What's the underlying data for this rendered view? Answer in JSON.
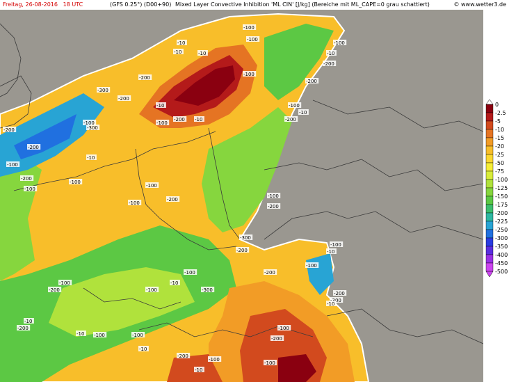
{
  "header": {
    "date": "Freitag, 26-08-2016",
    "time": "18 UTC",
    "model": "(GFS 0.25°) (D00+90)",
    "title": "Mixed Layer Convective Inhibition 'ML CIN' [J/kg] (Bereiche mit ML_CAPE=0 grau schattiert)",
    "credit": "© www.wetter3.de"
  },
  "legend": {
    "entries": [
      {
        "label": "0",
        "color": "#ffffff"
      },
      {
        "label": "-2.5",
        "color": "#8a0010"
      },
      {
        "label": "-5",
        "color": "#b41a1a"
      },
      {
        "label": "-10",
        "color": "#d24a1e"
      },
      {
        "label": "-15",
        "color": "#e57423"
      },
      {
        "label": "-20",
        "color": "#f29c26"
      },
      {
        "label": "-25",
        "color": "#f8be2a"
      },
      {
        "label": "-50",
        "color": "#fbd830"
      },
      {
        "label": "-75",
        "color": "#f6ee38"
      },
      {
        "label": "-100",
        "color": "#d8ec3a"
      },
      {
        "label": "-125",
        "color": "#b0e23c"
      },
      {
        "label": "-150",
        "color": "#86d63e"
      },
      {
        "label": "-175",
        "color": "#5cc844"
      },
      {
        "label": "-200",
        "color": "#3cbe6e"
      },
      {
        "label": "-225",
        "color": "#2eb8a2"
      },
      {
        "label": "-250",
        "color": "#28a4d4"
      },
      {
        "label": "-300",
        "color": "#2070e0"
      },
      {
        "label": "-350",
        "color": "#2a3ce2"
      },
      {
        "label": "-400",
        "color": "#5a2ee0"
      },
      {
        "label": "-450",
        "color": "#9a30e6"
      },
      {
        "label": "-500",
        "color": "#cc44f0"
      }
    ]
  },
  "map_labels": [
    "-10",
    "-10",
    "-100",
    "-100",
    "-10",
    "-100",
    "-200",
    "-300",
    "-200",
    "-100",
    "-200",
    "-300",
    "-200",
    "-100",
    "-10",
    "-200",
    "-100",
    "-10",
    "-100",
    "-200",
    "-100",
    "-10",
    "-100",
    "-200",
    "-100",
    "-200",
    "-100",
    "-10",
    "-200",
    "-100",
    "-200",
    "-100",
    "-10",
    "-200",
    "-300",
    "-200",
    "-100",
    "-10",
    "-100",
    "-200",
    "-100",
    "-10",
    "-100",
    "-300",
    "-200",
    "-100",
    "-10",
    "-200",
    "-100",
    "-10",
    "-10",
    "-100",
    "-300",
    "-200",
    "-10",
    "-100",
    "-200",
    "-100",
    "-10",
    "-200",
    "-100"
  ],
  "colors": {
    "no_cape": "#9a9790",
    "border": "#3a3a3a"
  }
}
